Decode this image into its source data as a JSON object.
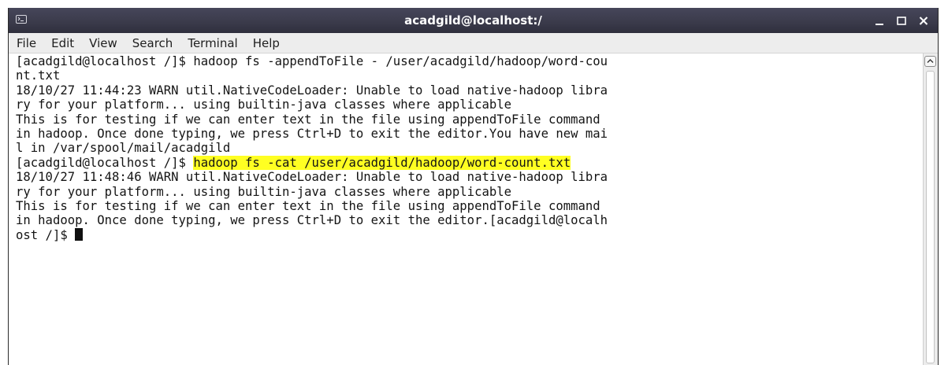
{
  "window": {
    "title": "acadgild@localhost:/"
  },
  "menu": {
    "items": [
      "File",
      "Edit",
      "View",
      "Search",
      "Terminal",
      "Help"
    ]
  },
  "terminal": {
    "prompt": "[acadgild@localhost /]$ ",
    "highlight_color": "#ffff22",
    "lines": [
      "[acadgild@localhost /]$ hadoop fs -appendToFile - /user/acadgild/hadoop/word-cou",
      "nt.txt",
      "18/10/27 11:44:23 WARN util.NativeCodeLoader: Unable to load native-hadoop libra",
      "ry for your platform... using builtin-java classes where applicable",
      "This is for testing if we can enter text in the file using appendToFile command",
      "in hadoop. Once done typing, we press Ctrl+D to exit the editor.You have new mai",
      "l in /var/spool/mail/acadgild"
    ],
    "highlighted_command": "hadoop fs -cat /user/acadgild/hadoop/word-count.txt",
    "lines_after": [
      "18/10/27 11:48:46 WARN util.NativeCodeLoader: Unable to load native-hadoop libra",
      "ry for your platform... using builtin-java classes where applicable",
      "This is for testing if we can enter text in the file using appendToFile command",
      "in hadoop. Once done typing, we press Ctrl+D to exit the editor.[acadgild@localh"
    ],
    "last_line": "ost /]$ "
  },
  "icons": {
    "terminal": "terminal-app-icon",
    "minimize": "minimize-icon",
    "maximize": "maximize-icon",
    "close": "close-icon",
    "scroll_up": "scroll-up-arrow-icon"
  }
}
